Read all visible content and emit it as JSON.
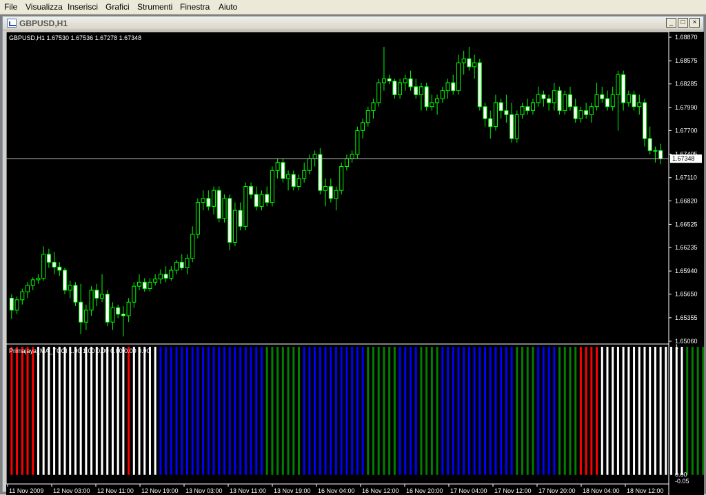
{
  "menu": {
    "items": [
      "File",
      "Visualizza",
      "Inserisci",
      "Grafici",
      "Strumenti",
      "Finestra",
      "Aiuto"
    ]
  },
  "window": {
    "title": "GBPUSD,H1",
    "min_glyph": "_",
    "max_glyph": "□",
    "close_glyph": "×"
  },
  "chart": {
    "info_label": "GBPUSD,H1  1.67530  1.67536  1.67278  1.67348",
    "indicator_label": "Primajaya_MA_TCCI 1.00  1.00  0.00  0.00  0.00  0.00",
    "current_price_label": "1.67348",
    "colors": {
      "bull": "#ffffff",
      "bear": "#ffffff",
      "wick": "#00ff00",
      "axis_text": "#ffffff",
      "grid_line": "#c0c0c0",
      "ind_red": "#ff0000",
      "ind_white": "#ffffff",
      "ind_blue": "#0000ff",
      "ind_green": "#008000"
    }
  },
  "chart_data": {
    "type": "candlestick",
    "symbol": "GBPUSD",
    "timeframe": "H1",
    "y_ticks": [
      "1.68870",
      "1.68575",
      "1.68285",
      "1.67990",
      "1.67700",
      "1.67405",
      "1.67110",
      "1.66820",
      "1.66525",
      "1.66235",
      "1.65940",
      "1.65650",
      "1.65355",
      "1.65060"
    ],
    "ylim": [
      1.6506,
      1.6887
    ],
    "x_ticks": [
      "11 Nov 2009",
      "12 Nov 03:00",
      "12 Nov 11:00",
      "12 Nov 19:00",
      "13 Nov 03:00",
      "13 Nov 11:00",
      "13 Nov 19:00",
      "16 Nov 04:00",
      "16 Nov 12:00",
      "16 Nov 20:00",
      "17 Nov 04:00",
      "17 Nov 12:00",
      "17 Nov 20:00",
      "18 Nov 04:00",
      "18 Nov 12:00"
    ],
    "last_close": 1.67348,
    "indicator": {
      "name": "Primajaya_MA_TCCI",
      "ylim": [
        -0.05,
        1
      ],
      "y_ticks": [
        "1",
        "0.00",
        "-0.05"
      ],
      "segments": [
        {
          "color": "red",
          "count": 5
        },
        {
          "color": "white",
          "count": 17
        },
        {
          "color": "red",
          "count": 1
        },
        {
          "color": "white",
          "count": 5
        },
        {
          "color": "blue",
          "count": 20
        },
        {
          "color": "green",
          "count": 7
        },
        {
          "color": "blue",
          "count": 12
        },
        {
          "color": "green",
          "count": 6
        },
        {
          "color": "blue",
          "count": 4
        },
        {
          "color": "green",
          "count": 4
        },
        {
          "color": "blue",
          "count": 14
        },
        {
          "color": "green",
          "count": 4
        },
        {
          "color": "blue",
          "count": 4
        },
        {
          "color": "green",
          "count": 4
        },
        {
          "color": "red",
          "count": 4
        },
        {
          "color": "white",
          "count": 16
        },
        {
          "color": "green",
          "count": 7
        },
        {
          "color": "red",
          "count": 2
        }
      ]
    },
    "ohlc": [
      [
        1.656,
        1.6565,
        1.6534,
        1.6545
      ],
      [
        1.6545,
        1.6562,
        1.654,
        1.6558
      ],
      [
        1.6558,
        1.6572,
        1.6552,
        1.6568
      ],
      [
        1.6568,
        1.658,
        1.656,
        1.6576
      ],
      [
        1.6576,
        1.6586,
        1.657,
        1.6583
      ],
      [
        1.6583,
        1.659,
        1.6578,
        1.6585
      ],
      [
        1.6585,
        1.6625,
        1.6582,
        1.6615
      ],
      [
        1.6615,
        1.6622,
        1.6598,
        1.6605
      ],
      [
        1.6605,
        1.6618,
        1.659,
        1.6599
      ],
      [
        1.6599,
        1.6605,
        1.6588,
        1.6595
      ],
      [
        1.6595,
        1.6598,
        1.6565,
        1.657
      ],
      [
        1.657,
        1.6582,
        1.656,
        1.6576
      ],
      [
        1.6576,
        1.658,
        1.655,
        1.6555
      ],
      [
        1.6555,
        1.6578,
        1.6515,
        1.653
      ],
      [
        1.653,
        1.6552,
        1.652,
        1.6545
      ],
      [
        1.6545,
        1.6575,
        1.6538,
        1.657
      ],
      [
        1.657,
        1.6578,
        1.655,
        1.656
      ],
      [
        1.656,
        1.659,
        1.6555,
        1.6565
      ],
      [
        1.6565,
        1.657,
        1.6525,
        1.653
      ],
      [
        1.653,
        1.6555,
        1.652,
        1.6548
      ],
      [
        1.6548,
        1.6552,
        1.6535,
        1.654
      ],
      [
        1.654,
        1.655,
        1.6512,
        1.6538
      ],
      [
        1.6538,
        1.656,
        1.653,
        1.6555
      ],
      [
        1.6555,
        1.658,
        1.6548,
        1.6575
      ],
      [
        1.6575,
        1.659,
        1.657,
        1.658
      ],
      [
        1.658,
        1.6585,
        1.6568,
        1.6572
      ],
      [
        1.6572,
        1.6585,
        1.6568,
        1.658
      ],
      [
        1.658,
        1.659,
        1.6576,
        1.6584
      ],
      [
        1.6584,
        1.6596,
        1.6578,
        1.659
      ],
      [
        1.659,
        1.66,
        1.658,
        1.6585
      ],
      [
        1.6585,
        1.66,
        1.6582,
        1.6595
      ],
      [
        1.6595,
        1.6608,
        1.659,
        1.6605
      ],
      [
        1.6605,
        1.6615,
        1.6595,
        1.6598
      ],
      [
        1.6598,
        1.6615,
        1.659,
        1.661
      ],
      [
        1.661,
        1.665,
        1.6605,
        1.664
      ],
      [
        1.664,
        1.6685,
        1.6635,
        1.668
      ],
      [
        1.668,
        1.6695,
        1.667,
        1.6685
      ],
      [
        1.6685,
        1.6695,
        1.667,
        1.6675
      ],
      [
        1.6675,
        1.67,
        1.6665,
        1.6695
      ],
      [
        1.6695,
        1.67,
        1.6655,
        1.666
      ],
      [
        1.666,
        1.669,
        1.6655,
        1.6685
      ],
      [
        1.6685,
        1.669,
        1.662,
        1.663
      ],
      [
        1.663,
        1.668,
        1.6625,
        1.667
      ],
      [
        1.667,
        1.668,
        1.6645,
        1.665
      ],
      [
        1.665,
        1.6705,
        1.6645,
        1.67
      ],
      [
        1.67,
        1.6705,
        1.6685,
        1.669
      ],
      [
        1.669,
        1.67,
        1.667,
        1.6675
      ],
      [
        1.6675,
        1.6695,
        1.667,
        1.669
      ],
      [
        1.669,
        1.67,
        1.6675,
        1.668
      ],
      [
        1.668,
        1.6725,
        1.6675,
        1.672
      ],
      [
        1.672,
        1.6735,
        1.671,
        1.673
      ],
      [
        1.673,
        1.6735,
        1.6705,
        1.671
      ],
      [
        1.671,
        1.672,
        1.6695,
        1.6715
      ],
      [
        1.6715,
        1.672,
        1.6695,
        1.67
      ],
      [
        1.67,
        1.6715,
        1.6695,
        1.671
      ],
      [
        1.671,
        1.673,
        1.6705,
        1.672
      ],
      [
        1.672,
        1.674,
        1.6715,
        1.6735
      ],
      [
        1.6735,
        1.6745,
        1.6725,
        1.674
      ],
      [
        1.674,
        1.6748,
        1.669,
        1.6695
      ],
      [
        1.6695,
        1.671,
        1.6675,
        1.67
      ],
      [
        1.67,
        1.671,
        1.668,
        1.6685
      ],
      [
        1.6685,
        1.67,
        1.667,
        1.6695
      ],
      [
        1.6695,
        1.673,
        1.669,
        1.6725
      ],
      [
        1.6725,
        1.674,
        1.672,
        1.6735
      ],
      [
        1.6735,
        1.6745,
        1.673,
        1.674
      ],
      [
        1.674,
        1.6775,
        1.6735,
        1.677
      ],
      [
        1.677,
        1.6785,
        1.676,
        1.678
      ],
      [
        1.678,
        1.68,
        1.6775,
        1.6795
      ],
      [
        1.6795,
        1.681,
        1.6785,
        1.6805
      ],
      [
        1.6805,
        1.6835,
        1.68,
        1.683
      ],
      [
        1.683,
        1.6875,
        1.682,
        1.6835
      ],
      [
        1.6835,
        1.684,
        1.6828,
        1.6832
      ],
      [
        1.6832,
        1.6835,
        1.681,
        1.6815
      ],
      [
        1.6815,
        1.6835,
        1.681,
        1.683
      ],
      [
        1.683,
        1.684,
        1.682,
        1.6835
      ],
      [
        1.6835,
        1.6845,
        1.682,
        1.6825
      ],
      [
        1.6825,
        1.6835,
        1.681,
        1.6815
      ],
      [
        1.6815,
        1.683,
        1.6795,
        1.6825
      ],
      [
        1.6825,
        1.683,
        1.6795,
        1.68
      ],
      [
        1.68,
        1.6815,
        1.6795,
        1.6805
      ],
      [
        1.6805,
        1.6815,
        1.679,
        1.681
      ],
      [
        1.681,
        1.6825,
        1.6805,
        1.682
      ],
      [
        1.682,
        1.6835,
        1.681,
        1.683
      ],
      [
        1.683,
        1.684,
        1.6815,
        1.682
      ],
      [
        1.682,
        1.6865,
        1.6815,
        1.6855
      ],
      [
        1.6855,
        1.687,
        1.684,
        1.686
      ],
      [
        1.686,
        1.6875,
        1.6845,
        1.685
      ],
      [
        1.685,
        1.6865,
        1.6835,
        1.6855
      ],
      [
        1.6855,
        1.686,
        1.6795,
        1.68
      ],
      [
        1.68,
        1.6805,
        1.6775,
        1.6785
      ],
      [
        1.6785,
        1.6795,
        1.676,
        1.6775
      ],
      [
        1.6775,
        1.6815,
        1.677,
        1.6805
      ],
      [
        1.6805,
        1.681,
        1.6785,
        1.6795
      ],
      [
        1.6795,
        1.6815,
        1.678,
        1.679
      ],
      [
        1.679,
        1.6805,
        1.6755,
        1.676
      ],
      [
        1.676,
        1.6795,
        1.6755,
        1.679
      ],
      [
        1.679,
        1.6805,
        1.6785,
        1.68
      ],
      [
        1.68,
        1.681,
        1.679,
        1.6795
      ],
      [
        1.6795,
        1.681,
        1.679,
        1.6805
      ],
      [
        1.6805,
        1.6825,
        1.68,
        1.6815
      ],
      [
        1.6815,
        1.682,
        1.68,
        1.681
      ],
      [
        1.681,
        1.6815,
        1.6795,
        1.6805
      ],
      [
        1.6805,
        1.683,
        1.6795,
        1.682
      ],
      [
        1.682,
        1.6825,
        1.679,
        1.6795
      ],
      [
        1.6795,
        1.682,
        1.679,
        1.6815
      ],
      [
        1.6815,
        1.6825,
        1.6795,
        1.68
      ],
      [
        1.68,
        1.681,
        1.678,
        1.6785
      ],
      [
        1.6785,
        1.68,
        1.678,
        1.6795
      ],
      [
        1.6795,
        1.6805,
        1.6785,
        1.679
      ],
      [
        1.679,
        1.6805,
        1.678,
        1.68
      ],
      [
        1.68,
        1.683,
        1.6795,
        1.6815
      ],
      [
        1.6815,
        1.6825,
        1.6805,
        1.681
      ],
      [
        1.681,
        1.682,
        1.6795,
        1.68
      ],
      [
        1.68,
        1.6825,
        1.6795,
        1.6815
      ],
      [
        1.6815,
        1.6845,
        1.677,
        1.684
      ],
      [
        1.684,
        1.6845,
        1.6795,
        1.6805
      ],
      [
        1.6805,
        1.682,
        1.68,
        1.6815
      ],
      [
        1.6815,
        1.682,
        1.6795,
        1.68
      ],
      [
        1.68,
        1.6815,
        1.679,
        1.6805
      ],
      [
        1.6805,
        1.681,
        1.675,
        1.676
      ],
      [
        1.676,
        1.6775,
        1.674,
        1.6745
      ],
      [
        1.6745,
        1.675,
        1.673,
        1.6745
      ],
      [
        1.6745,
        1.67536,
        1.67278,
        1.67348
      ]
    ]
  }
}
